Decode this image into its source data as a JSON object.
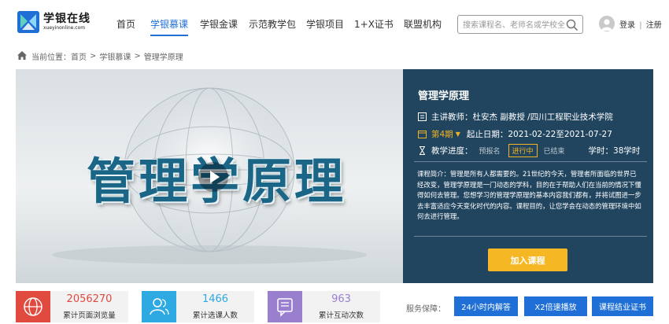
{
  "header": {
    "logo_cn": "学银在线",
    "logo_en": "xueyinonline.com",
    "nav": [
      {
        "label": "首页",
        "active": false
      },
      {
        "label": "学银慕课",
        "active": true
      },
      {
        "label": "学银金课",
        "active": false
      },
      {
        "label": "示范教学包",
        "active": false
      },
      {
        "label": "学银项目",
        "active": false
      },
      {
        "label": "1+X证书",
        "active": false
      },
      {
        "label": "联盟机构",
        "active": false
      }
    ],
    "search_placeholder": "搜索课程名、老师名或学校全称",
    "login": "登录",
    "separator": "|",
    "register": "注册"
  },
  "breadcrumb": {
    "prefix": "当前位置：",
    "items": [
      "首页",
      ">",
      "学银慕课",
      ">",
      "管理学原理"
    ]
  },
  "video": {
    "title": "管理学原理"
  },
  "course": {
    "name": "管理学原理",
    "teacher_label": "主讲教师：",
    "teacher": "杜安杰 副教授 /四川工程职业技术学院",
    "period": "第4期",
    "date_label": "起止日期：",
    "dates": "2021-02-22至2021-07-27",
    "progress_label": "教学进度：",
    "stages": [
      "预报名",
      "进行中",
      "已结束"
    ],
    "current_stage": "进行中",
    "hours_label": "学时：",
    "hours": "38学时",
    "description": "课程简介：管理是所有人都需要的。21世纪的今天，管理者所面临的世界已经改变，管理学原理是一门动态的学科，目的在于帮助人们在当前的情况下懂得如何去管理。您想学习的管理学原理的基本内容我们都有，并将试图进一步去丰富适应今天变化时代的内容。课程目的，让您学会在动态的管理环境中如何去进行管理。",
    "join_button": "加入课程"
  },
  "stats": [
    {
      "value": "2056270",
      "label": "累计页面浏览量",
      "color": "#e04a3f",
      "icon": "globe-icon"
    },
    {
      "value": "1466",
      "label": "累计选课人数",
      "color": "#2fa9e1",
      "icon": "users-icon"
    },
    {
      "value": "963",
      "label": "累计互动次数",
      "color": "#9b7fcf",
      "icon": "chat-icon"
    }
  ],
  "service": {
    "label": "服务保障：",
    "buttons": [
      "24小时内解答",
      "X2倍速播放",
      "课程结业证书"
    ]
  }
}
